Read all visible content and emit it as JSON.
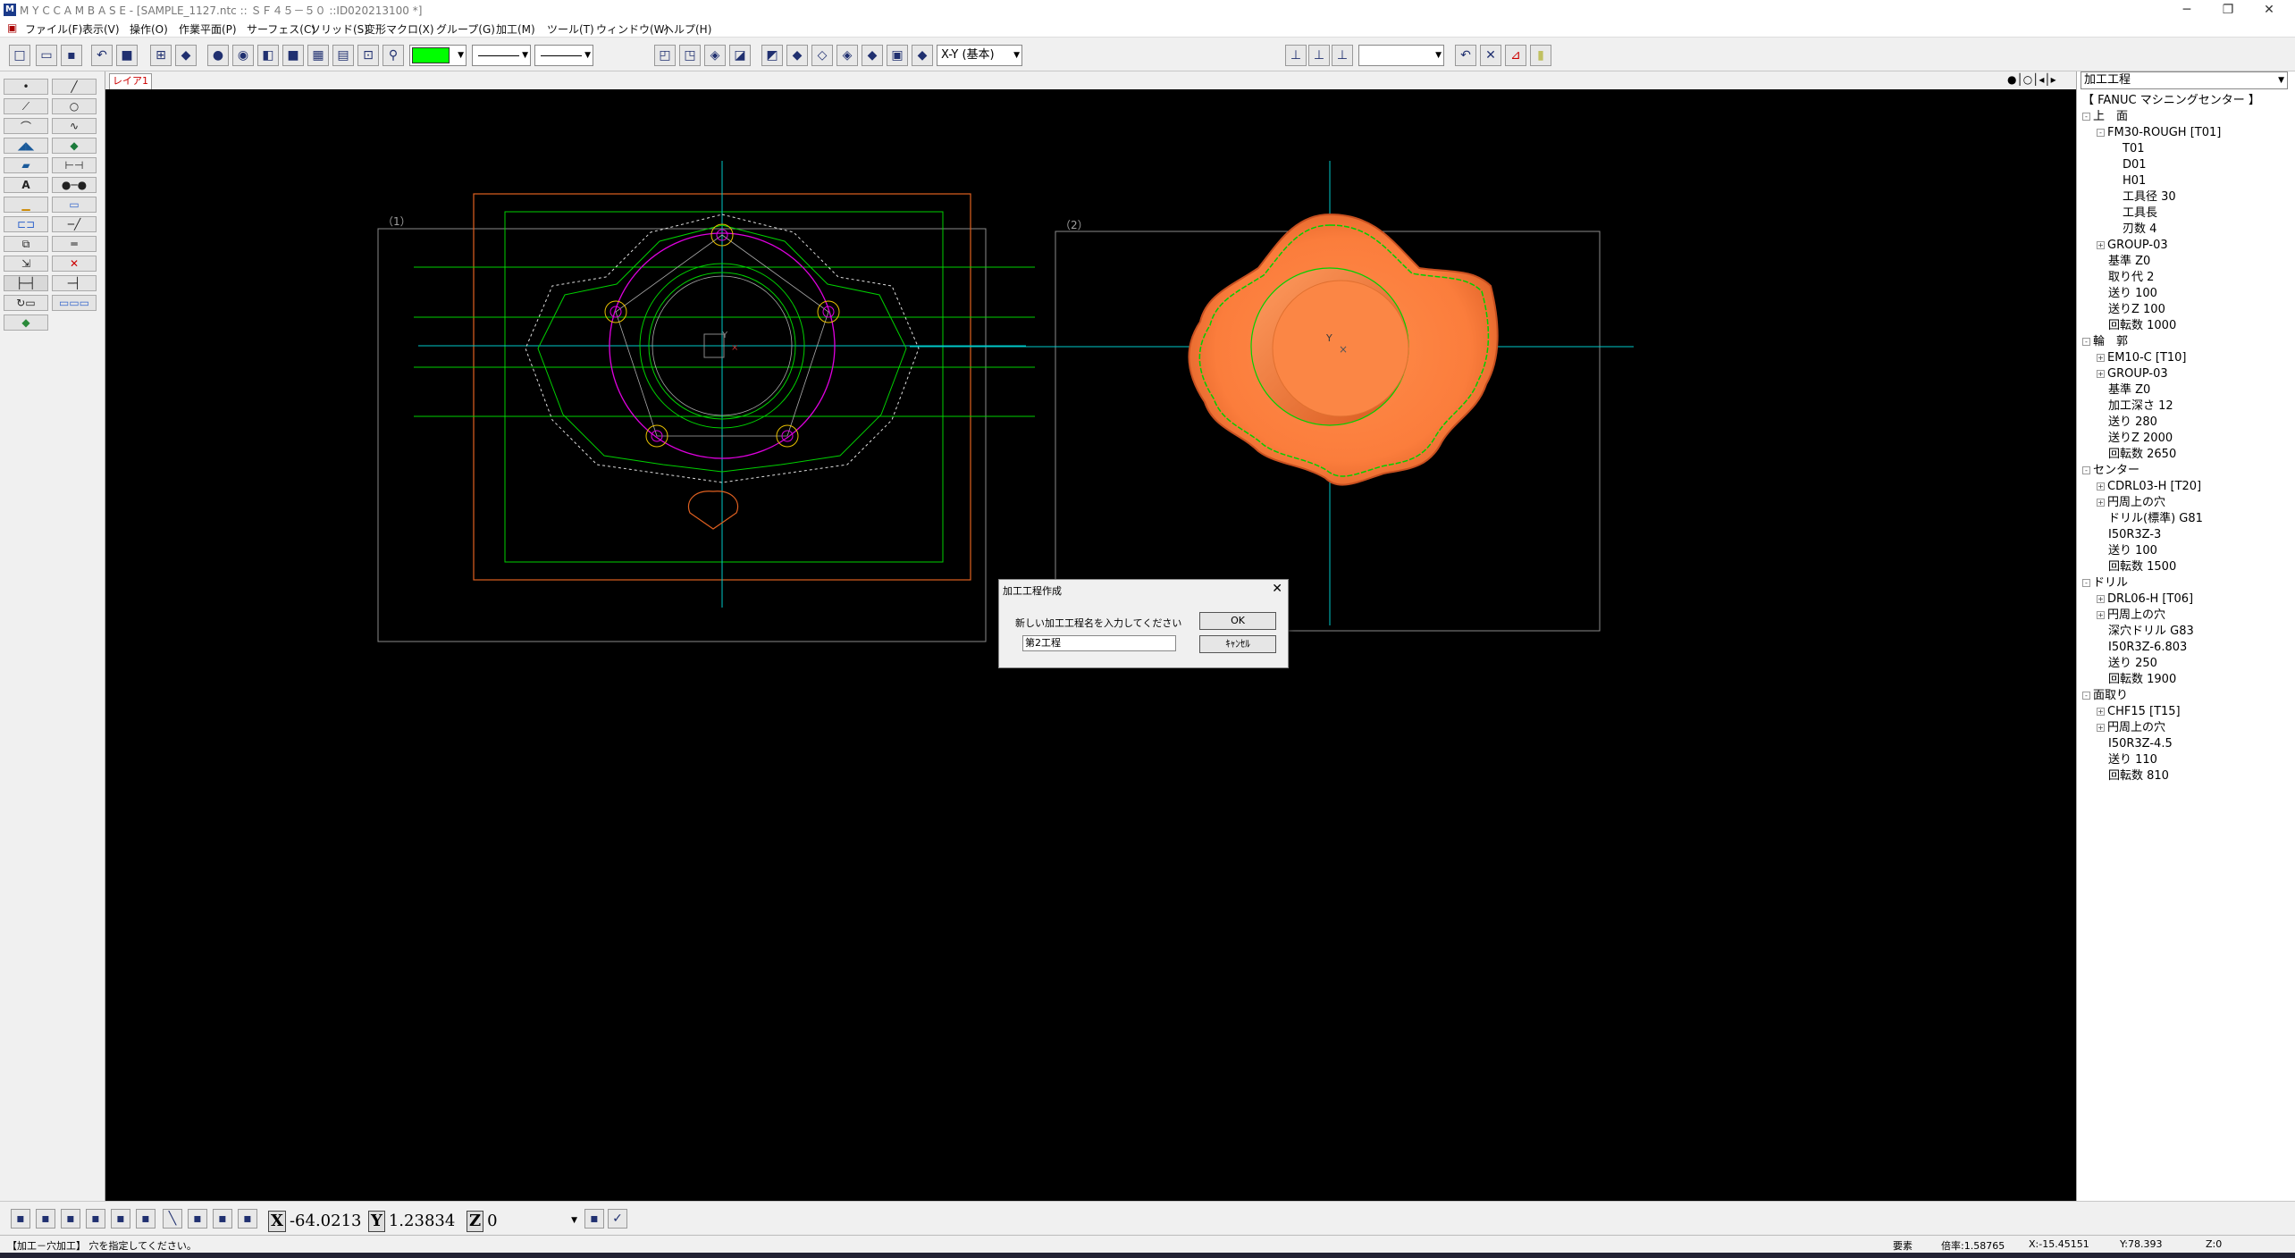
{
  "window": {
    "title": "M Y C  C A M B A S E  - [SAMPLE_1127.ntc :: ＳＦ４５－５０ ::ID020213100 *]",
    "minimize": "─",
    "restore": "❐",
    "close": "✕"
  },
  "menu": [
    "ファイル(F)",
    "表示(V)",
    "操作(O)",
    "作業平面(P)",
    "サーフェス(C)",
    "ソリッド(S)",
    "変形マクロ(X)",
    "グループ(G)",
    "加工(M)",
    "ツール(T)",
    "ウィンドウ(W)",
    "ヘルプ(H)"
  ],
  "toolbar": {
    "plane_select": "X-Y (基本)",
    "color_swatch": "#00ff00"
  },
  "tabs": {
    "layout": "レイア1"
  },
  "viewports": {
    "left_label": "（1）",
    "right_label": "（2）"
  },
  "panel": {
    "combo": "加工工程",
    "tree": [
      {
        "label": "【 FANUC マシニングセンター 】",
        "level": 0,
        "exp": ""
      },
      {
        "label": "上　面",
        "level": 0,
        "exp": "-"
      },
      {
        "label": "FM30-ROUGH [T01]",
        "level": 1,
        "exp": "-"
      },
      {
        "label": "T01",
        "level": 2,
        "exp": ""
      },
      {
        "label": "D01",
        "level": 2,
        "exp": ""
      },
      {
        "label": "H01",
        "level": 2,
        "exp": ""
      },
      {
        "label": "工具径 30",
        "level": 2,
        "exp": ""
      },
      {
        "label": "工具長",
        "level": 2,
        "exp": ""
      },
      {
        "label": "刃数 4",
        "level": 2,
        "exp": ""
      },
      {
        "label": "GROUP-03",
        "level": 1,
        "exp": "+"
      },
      {
        "label": "基準 Z0",
        "level": 1,
        "exp": ""
      },
      {
        "label": "取り代 2",
        "level": 1,
        "exp": ""
      },
      {
        "label": "送り 100",
        "level": 1,
        "exp": ""
      },
      {
        "label": "送りZ 100",
        "level": 1,
        "exp": ""
      },
      {
        "label": "回転数 1000",
        "level": 1,
        "exp": ""
      },
      {
        "label": "輪　郭",
        "level": 0,
        "exp": "-"
      },
      {
        "label": "EM10-C [T10]",
        "level": 1,
        "exp": "+"
      },
      {
        "label": "GROUP-03",
        "level": 1,
        "exp": "+"
      },
      {
        "label": "基準 Z0",
        "level": 1,
        "exp": ""
      },
      {
        "label": "加工深さ 12",
        "level": 1,
        "exp": ""
      },
      {
        "label": "送り 280",
        "level": 1,
        "exp": ""
      },
      {
        "label": "送りZ 2000",
        "level": 1,
        "exp": ""
      },
      {
        "label": "回転数 2650",
        "level": 1,
        "exp": ""
      },
      {
        "label": "センター",
        "level": 0,
        "exp": "-"
      },
      {
        "label": "CDRL03-H [T20]",
        "level": 1,
        "exp": "+"
      },
      {
        "label": "円周上の穴",
        "level": 1,
        "exp": "+"
      },
      {
        "label": "ドリル(標準) G81",
        "level": 1,
        "exp": ""
      },
      {
        "label": "I50R3Z-3",
        "level": 1,
        "exp": ""
      },
      {
        "label": "送り 100",
        "level": 1,
        "exp": ""
      },
      {
        "label": "回転数 1500",
        "level": 1,
        "exp": ""
      },
      {
        "label": "ドリル",
        "level": 0,
        "exp": "-"
      },
      {
        "label": "DRL06-H [T06]",
        "level": 1,
        "exp": "+"
      },
      {
        "label": "円周上の穴",
        "level": 1,
        "exp": "+"
      },
      {
        "label": "深穴ドリル G83",
        "level": 1,
        "exp": ""
      },
      {
        "label": "I50R3Z-6.803",
        "level": 1,
        "exp": ""
      },
      {
        "label": "送り 250",
        "level": 1,
        "exp": ""
      },
      {
        "label": "回転数 1900",
        "level": 1,
        "exp": ""
      },
      {
        "label": "面取り",
        "level": 0,
        "exp": "-"
      },
      {
        "label": "CHF15 [T15]",
        "level": 1,
        "exp": "+"
      },
      {
        "label": "円周上の穴",
        "level": 1,
        "exp": "+"
      },
      {
        "label": "I50R3Z-4.5",
        "level": 1,
        "exp": ""
      },
      {
        "label": "送り 110",
        "level": 1,
        "exp": ""
      },
      {
        "label": "回転数 810",
        "level": 1,
        "exp": ""
      }
    ]
  },
  "dialog": {
    "title": "加工工程作成",
    "close": "✕",
    "prompt": "新しい加工工程名を入力してください",
    "input_value": "第2工程",
    "ok": "OK",
    "cancel": "ｷｬﾝｾﾙ"
  },
  "coords": {
    "x_label": "X",
    "x_value": "-64.0213",
    "y_label": "Y",
    "y_value": "1.23834",
    "z_label": "Z",
    "z_value": "0"
  },
  "status": {
    "message": "【加工－穴加工】 穴を指定してください。",
    "mode": "要素",
    "scale": "倍率:1.58765",
    "x": "X:-15.45151",
    "y": "Y:78.393",
    "z": "Z:0"
  }
}
